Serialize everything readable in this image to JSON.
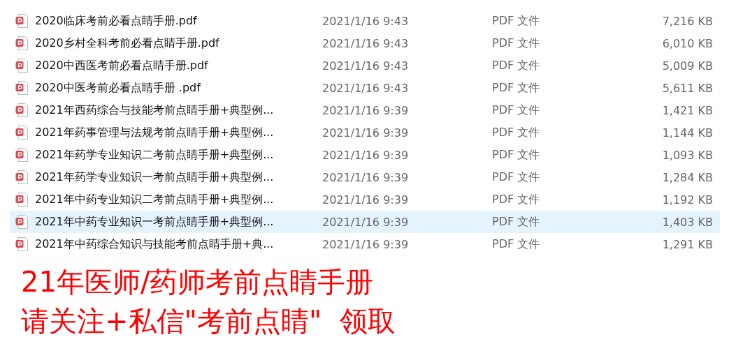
{
  "files": [
    {
      "name": "2020临床考前必看点睛手册.pdf",
      "modified": "2021/1/16 9:43",
      "type": "PDF 文件",
      "size": "7,216 KB",
      "selected": false
    },
    {
      "name": "2020乡村全科考前必看点睛手册.pdf",
      "modified": "2021/1/16 9:43",
      "type": "PDF 文件",
      "size": "6,010 KB",
      "selected": false
    },
    {
      "name": "2020中西医考前必看点睛手册.pdf",
      "modified": "2021/1/16 9:43",
      "type": "PDF 文件",
      "size": "5,009 KB",
      "selected": false
    },
    {
      "name": "2020中医考前必看点睛手册 .pdf",
      "modified": "2021/1/16 9:43",
      "type": "PDF 文件",
      "size": "5,611 KB",
      "selected": false
    },
    {
      "name": "2021年西药综合与技能考前点睛手册+典型例...",
      "modified": "2021/1/16 9:39",
      "type": "PDF 文件",
      "size": "1,421 KB",
      "selected": false
    },
    {
      "name": "2021年药事管理与法规考前点睛手册+典型例...",
      "modified": "2021/1/16 9:39",
      "type": "PDF 文件",
      "size": "1,144 KB",
      "selected": false
    },
    {
      "name": "2021年药学专业知识二考前点睛手册+典型例...",
      "modified": "2021/1/16 9:39",
      "type": "PDF 文件",
      "size": "1,093 KB",
      "selected": false
    },
    {
      "name": "2021年药学专业知识一考前点睛手册+典型例...",
      "modified": "2021/1/16 9:39",
      "type": "PDF 文件",
      "size": "1,284 KB",
      "selected": false
    },
    {
      "name": "2021年中药专业知识二考前点睛手册+典型例...",
      "modified": "2021/1/16 9:39",
      "type": "PDF 文件",
      "size": "1,192 KB",
      "selected": false
    },
    {
      "name": "2021年中药专业知识一考前点睛手册+典型例...",
      "modified": "2021/1/16 9:39",
      "type": "PDF 文件",
      "size": "1,403 KB",
      "selected": true
    },
    {
      "name": "2021年中药综合知识与技能考前点睛手册+典...",
      "modified": "2021/1/16 9:39",
      "type": "PDF 文件",
      "size": "1,291 KB",
      "selected": false
    }
  ],
  "caption": [
    "21年医师/药师考前点睛手册",
    "请关注+私信\"考前点睛\"  领取"
  ]
}
